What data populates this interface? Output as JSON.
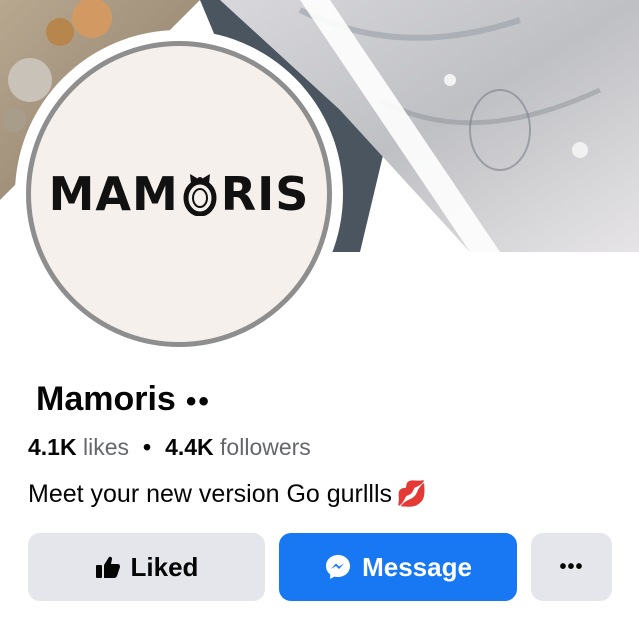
{
  "cover": {
    "description_icon": "cover-photo"
  },
  "avatar": {
    "logo_text_left": "MAM",
    "logo_text_right": "RIS"
  },
  "page": {
    "name": "Mamoris",
    "name_dots": "••"
  },
  "stats": {
    "likes_count": "4.1K",
    "likes_label": "likes",
    "separator": "•",
    "followers_count": "4.4K",
    "followers_label": "followers"
  },
  "bio": {
    "text": "Meet your new version Go gurllls",
    "emoji": "💋"
  },
  "actions": {
    "liked_label": "Liked",
    "message_label": "Message",
    "more_label": "•••"
  },
  "colors": {
    "primary": "#1877f2",
    "secondary_btn": "#e4e6eb",
    "muted_text": "#65676b"
  }
}
